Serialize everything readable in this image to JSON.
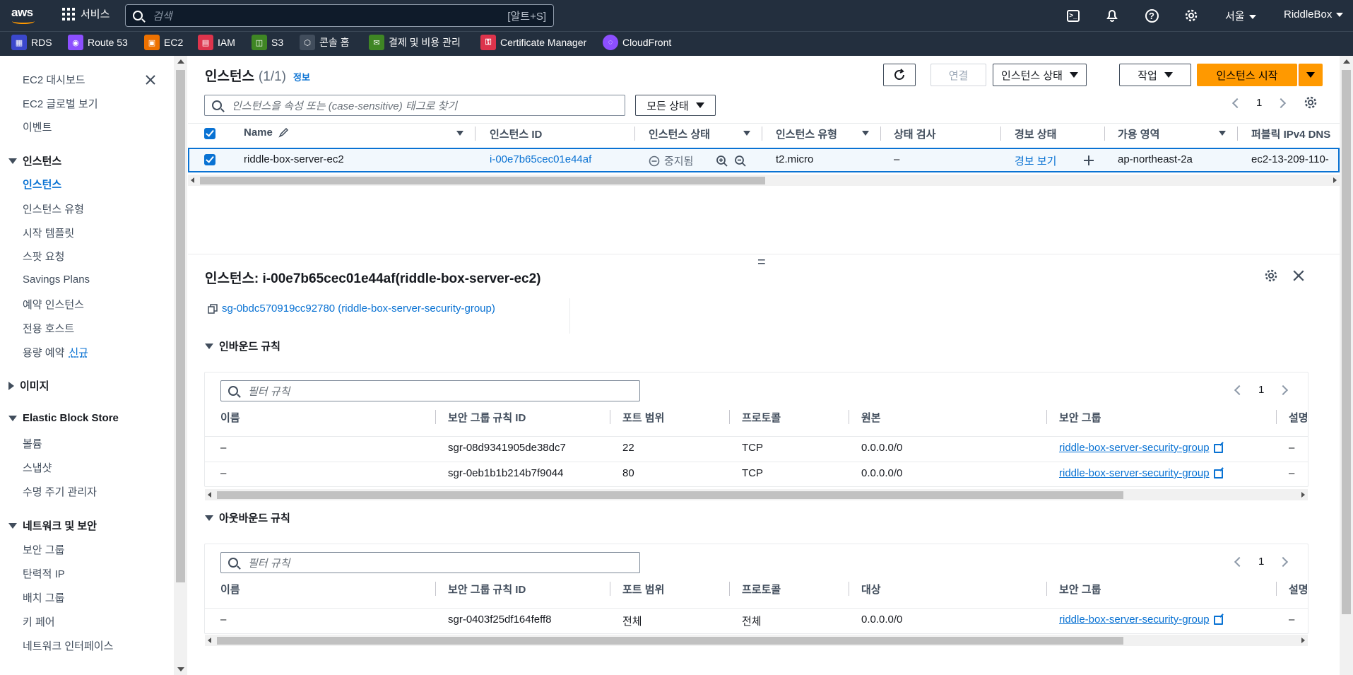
{
  "topnav": {
    "logo": "aws",
    "services_label": "서비스",
    "search_placeholder": "검색",
    "search_shortcut": "[알트+S]",
    "region": "서울",
    "account": "RiddleBox"
  },
  "favorites": [
    {
      "label": "RDS",
      "color": "#3b48cc",
      "icon": "rds-icon"
    },
    {
      "label": "Route 53",
      "color": "#8c4fff",
      "icon": "route53-icon"
    },
    {
      "label": "EC2",
      "color": "#ed7100",
      "icon": "ec2-icon"
    },
    {
      "label": "IAM",
      "color": "#dd344c",
      "icon": "iam-icon"
    },
    {
      "label": "S3",
      "color": "#3f8624",
      "icon": "s3-icon"
    },
    {
      "label": "콘솔 홈",
      "color": "#414d5c",
      "icon": "console-home-icon"
    },
    {
      "label": "결제 및 비용 관리",
      "color": "#3f8624",
      "icon": "billing-icon"
    },
    {
      "label": "Certificate Manager",
      "color": "#dd344c",
      "icon": "certificate-manager-icon"
    },
    {
      "label": "CloudFront",
      "color": "#8c4fff",
      "icon": "cloudfront-icon"
    }
  ],
  "sidebar": {
    "top_items": [
      "EC2 대시보드",
      "EC2 글로벌 보기",
      "이벤트"
    ],
    "instances_section": "인스턴스",
    "instances_items": [
      "인스턴스",
      "인스턴스 유형",
      "시작 템플릿",
      "스팟 요청",
      "Savings Plans",
      "예약 인스턴스",
      "전용 호스트",
      "용량 예약"
    ],
    "new_badge": "신규",
    "images_section": "이미지",
    "ebs_section": "Elastic Block Store",
    "ebs_items": [
      "볼륨",
      "스냅샷",
      "수명 주기 관리자"
    ],
    "network_section": "네트워크 및 보안",
    "network_items": [
      "보안 그룹",
      "탄력적 IP",
      "배치 그룹",
      "키 페어",
      "네트워크 인터페이스"
    ]
  },
  "instances": {
    "title": "인스턴스",
    "count": "(1/1)",
    "info": "정보",
    "connect": "연결",
    "state_menu": "인스턴스 상태",
    "actions": "작업",
    "launch": "인스턴스 시작",
    "search_placeholder": "인스턴스을 속성 또는 (case-sensitive) 태그로 찾기",
    "state_filter": "모든 상태",
    "page": "1",
    "columns": [
      "Name",
      "인스턴스 ID",
      "인스턴스 상태",
      "인스턴스 유형",
      "상태 검사",
      "경보 상태",
      "가용 영역",
      "퍼블릭 IPv4 DNS"
    ],
    "row": {
      "name": "riddle-box-server-ec2",
      "id": "i-00e7b65cec01e44af",
      "state": "중지됨",
      "type": "t2.micro",
      "check": "–",
      "alarm": "경보 보기",
      "az": "ap-northeast-2a",
      "dns": "ec2-13-209-110-"
    }
  },
  "detail": {
    "drag_handle": "=",
    "title": "인스턴스: i-00e7b65cec01e44af(riddle-box-server-ec2)",
    "sg_link": "sg-0bdc570919cc92780 (riddle-box-server-security-group)",
    "inbound": {
      "title": "인바운드 규칙",
      "filter_placeholder": "필터 규칙",
      "page": "1",
      "columns": [
        "이름",
        "보안 그룹 규칙 ID",
        "포트 범위",
        "프로토콜",
        "원본",
        "보안 그룹",
        "설명"
      ],
      "rows": [
        [
          "–",
          "sgr-08d9341905de38dc7",
          "22",
          "TCP",
          "0.0.0.0/0",
          "riddle-box-server-security-group",
          "–"
        ],
        [
          "–",
          "sgr-0eb1b1b214b7f9044",
          "80",
          "TCP",
          "0.0.0.0/0",
          "riddle-box-server-security-group",
          "–"
        ]
      ]
    },
    "outbound": {
      "title": "아웃바운드 규칙",
      "filter_placeholder": "필터 규칙",
      "page": "1",
      "columns": [
        "이름",
        "보안 그룹 규칙 ID",
        "포트 범위",
        "프로토콜",
        "대상",
        "보안 그룹",
        "설명"
      ],
      "rows": [
        [
          "–",
          "sgr-0403f25df164feff8",
          "전체",
          "전체",
          "0.0.0.0/0",
          "riddle-box-server-security-group",
          "–"
        ]
      ]
    }
  },
  "colors": {
    "nav_bg": "#232f3e",
    "link": "#0972d3",
    "primary": "#ff9900",
    "selected_row": "#f2f8fd"
  }
}
